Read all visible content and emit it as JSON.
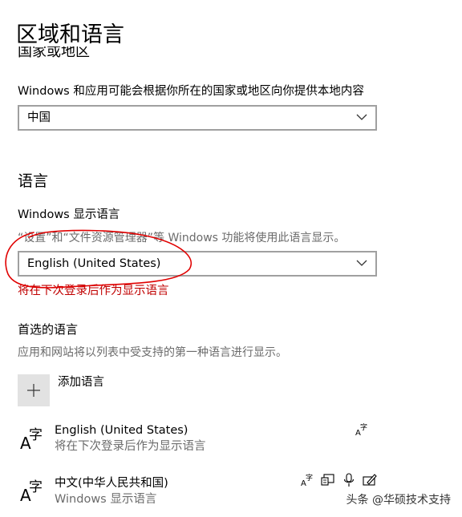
{
  "page": {
    "title": "区域和语言"
  },
  "region": {
    "heading": "国家或地区",
    "description": "Windows 和应用可能会根据你所在的国家或地区向你提供本地内容",
    "selected": "中国"
  },
  "language": {
    "heading": "语言",
    "display_language_label": "Windows 显示语言",
    "display_language_description": "“设置”和“文件资源管理器”等 Windows 功能将使用此语言显示。",
    "selected": "English (United States)",
    "note": "将在下次登录后作为显示语言",
    "note_color": "#c00000",
    "annotation_color": "#e00000"
  },
  "preferred": {
    "heading": "首选的语言",
    "description": "应用和网站将以列表中受支持的第一种语言进行显示。",
    "add_label": "添加语言",
    "items": [
      {
        "name": "English (United States)",
        "subtitle": "将在下次登录后作为显示语言",
        "icons": [
          "display-language-icon"
        ]
      },
      {
        "name": "中文(中华人民共和国)",
        "subtitle": "Windows 显示语言",
        "icons": [
          "display-language-icon",
          "text-to-speech-icon",
          "speech-icon",
          "handwriting-icon"
        ]
      }
    ]
  },
  "watermark": "头条 @华硕技术支持"
}
